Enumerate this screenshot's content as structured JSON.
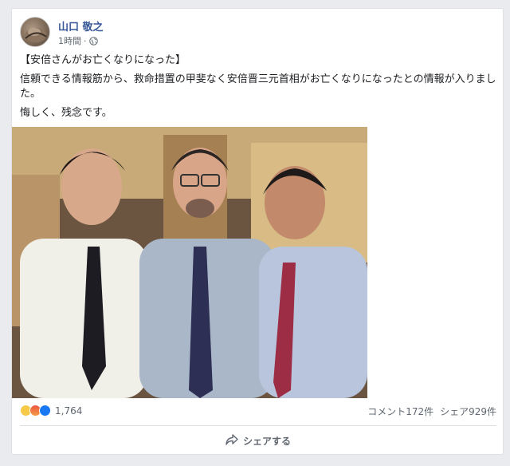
{
  "post": {
    "author": "山口 敬之",
    "time": "1時間",
    "separator": "·",
    "privacy_icon": "globe-icon",
    "text": {
      "headline": "【安倍さんがお亡くなりになった】",
      "body": "信頼できる情報筋から、救命措置の甲斐なく安倍晋三元首相がお亡くなりになったとの情報が入りました。",
      "closing": "悔しく、残念です。"
    }
  },
  "stats": {
    "reactions": [
      "sad-reaction-icon",
      "angry-reaction-icon",
      "like-reaction-icon"
    ],
    "reaction_count": "1,764",
    "comments": "コメント172件",
    "shares": "シェア929件"
  },
  "actions": {
    "share_label": "シェアする"
  },
  "colors": {
    "author_link": "#385898",
    "meta_text": "#606770",
    "background": "#e9ebee",
    "like_blue": "#1877f2"
  }
}
